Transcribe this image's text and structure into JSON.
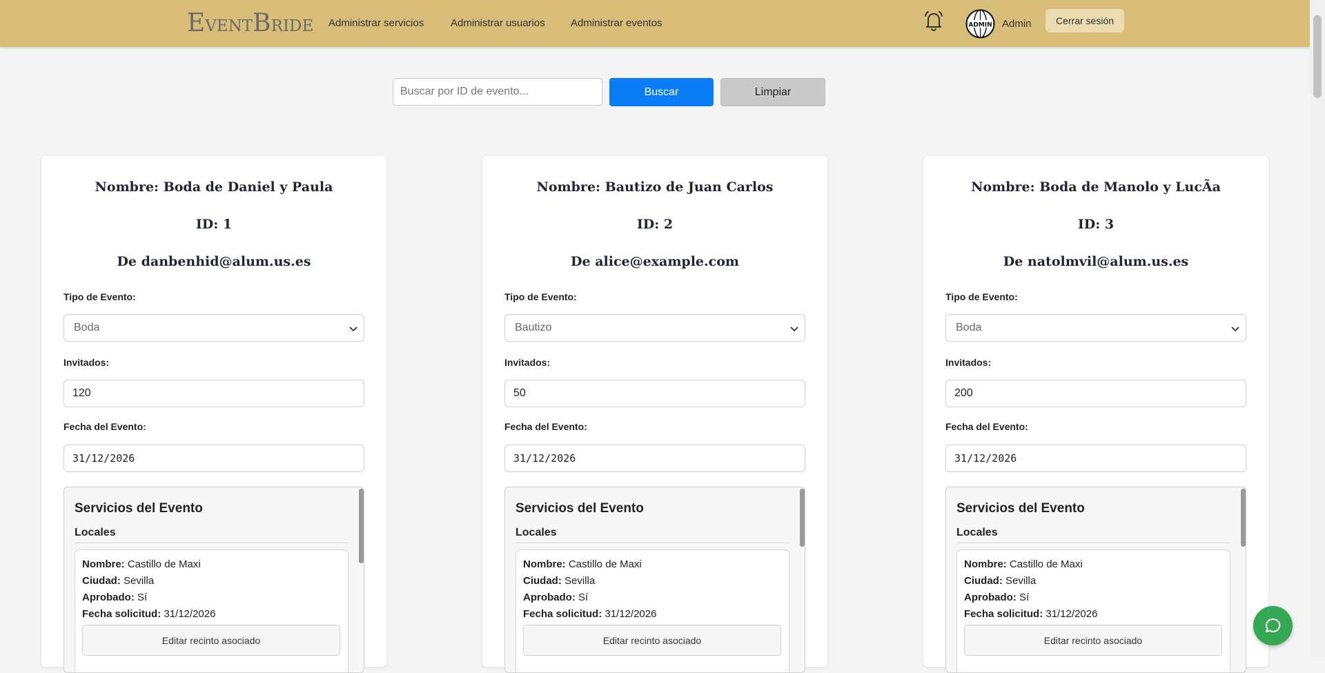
{
  "header": {
    "logo": {
      "e": "E",
      "vent": "VENT",
      "b": "B",
      "ride": "RIDE"
    },
    "nav": [
      "Administrar servicios",
      "Administrar usuarios",
      "Administrar eventos"
    ],
    "avatar_text": "ADMIN",
    "user_name": "Admin",
    "logout_label": "Cerrar sesión",
    "colors": {
      "bar": "#d8bd78",
      "logout_bg": "#eadbb1"
    }
  },
  "search": {
    "placeholder": "Buscar por ID de evento...",
    "search_label": "Buscar",
    "clear_label": "Limpiar",
    "colors": {
      "primary": "#0a7cf5",
      "secondary": "#cacaca"
    }
  },
  "labels": {
    "type": "Tipo de Evento:",
    "guests": "Invitados:",
    "date": "Fecha del Evento:",
    "services_title": "Servicios del Evento",
    "venues": "Locales",
    "venue_name": "Nombre:",
    "venue_city": "Ciudad:",
    "venue_approved": "Aprobado:",
    "venue_requested": "Fecha solicitud:",
    "venue_button": "Editar recinto asociado"
  },
  "events": [
    {
      "title": "Nombre: Boda de Daniel y Paula",
      "id": "ID: 1",
      "owner": "De danbenhid@alum.us.es",
      "type": "Boda",
      "guests": "120",
      "date": "31/12/2026",
      "venue": {
        "name": "Castillo de Maxi",
        "city": "Sevilla",
        "approved": "Sí",
        "requested": "31/12/2026"
      }
    },
    {
      "title": "Nombre: Bautizo de Juan Carlos",
      "id": "ID: 2",
      "owner": "De alice@example.com",
      "type": "Bautizo",
      "guests": "50",
      "date": "31/12/2026",
      "venue": {
        "name": "Castillo de Maxi",
        "city": "Sevilla",
        "approved": "Sí",
        "requested": "31/12/2026"
      }
    },
    {
      "title": "Nombre: Boda de Manolo y LucÃa",
      "id": "ID: 3",
      "owner": "De natolmvil@alum.us.es",
      "type": "Boda",
      "guests": "200",
      "date": "31/12/2026",
      "venue": {
        "name": "Castillo de Maxi",
        "city": "Sevilla",
        "approved": "Sí",
        "requested": "31/12/2026"
      }
    }
  ],
  "icons": [
    "bell-icon",
    "avatar-globe-icon",
    "chevron-down-icon",
    "chat-icon"
  ],
  "chat_color": "#34a853"
}
